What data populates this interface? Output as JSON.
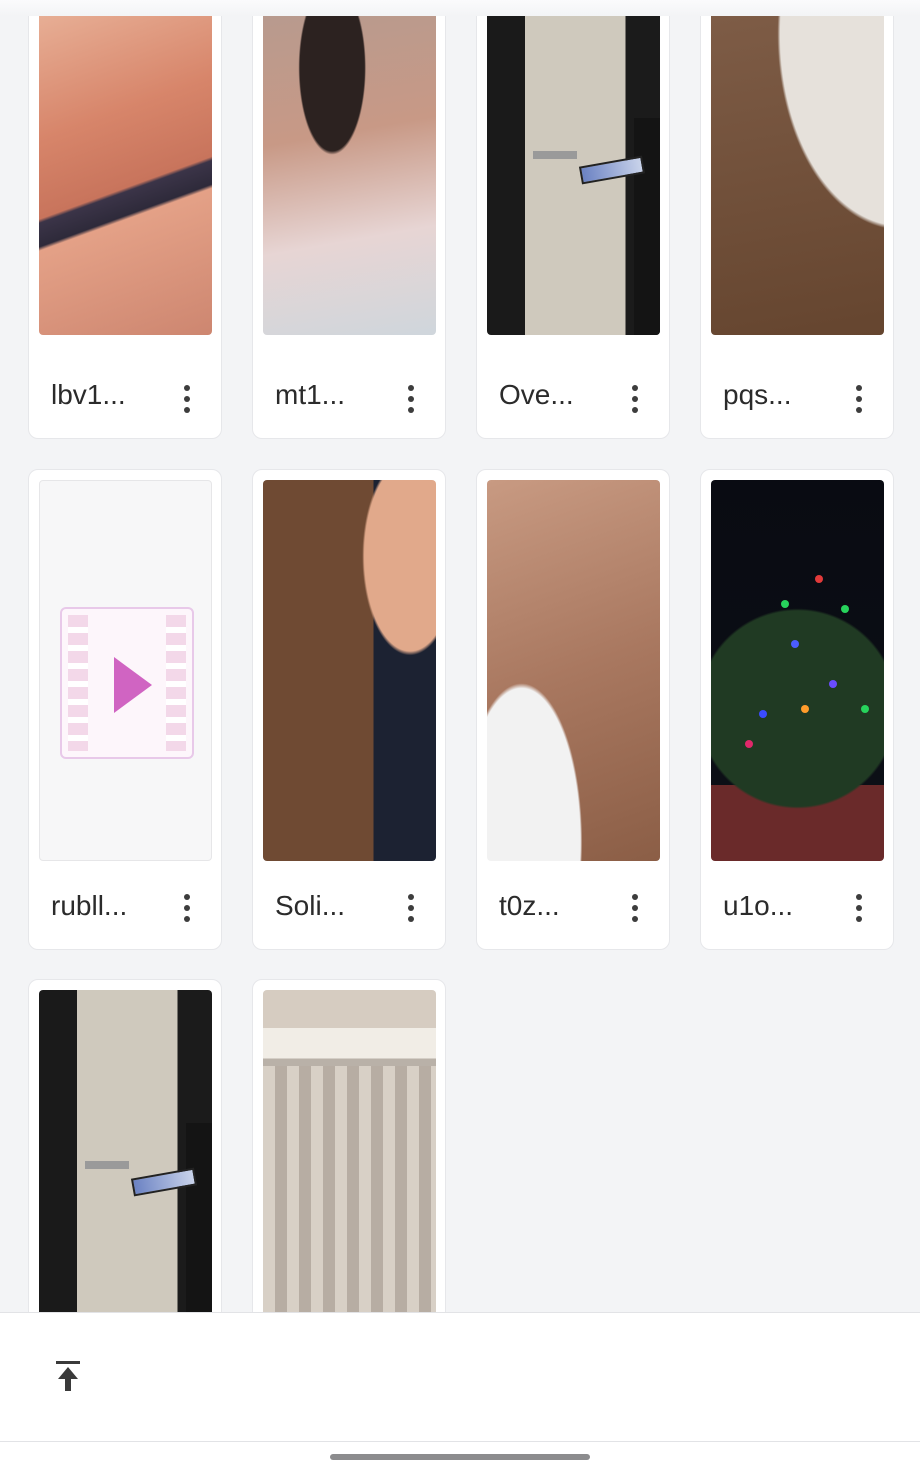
{
  "gallery": {
    "items": [
      {
        "caption": "lbv1...",
        "thumb": "skin1"
      },
      {
        "caption": "mt1...",
        "thumb": "skin2"
      },
      {
        "caption": "Ove...",
        "thumb": "door"
      },
      {
        "caption": "pqs...",
        "thumb": "skin3b"
      },
      {
        "caption": "rubll...",
        "thumb": "placeholder"
      },
      {
        "caption": "Soli...",
        "thumb": "skin4"
      },
      {
        "caption": "t0z...",
        "thumb": "skin5"
      },
      {
        "caption": "u1o...",
        "thumb": "tree"
      },
      {
        "caption": "",
        "thumb": "door"
      },
      {
        "caption": "",
        "thumb": "curtain"
      }
    ]
  },
  "bottom_bar": {
    "scroll_top_icon": "vertical-align-top-icon"
  },
  "colors": {
    "background": "#f3f4f6",
    "card": "#ffffff",
    "play_accent": "#d064c2"
  }
}
